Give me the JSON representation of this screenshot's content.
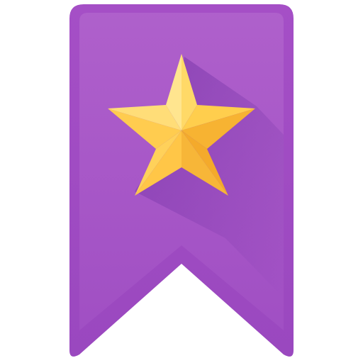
{
  "icon": {
    "name": "bookmark-star-icon",
    "ribbon_color": "#9f4cc3",
    "ribbon_inner_color": "#a956c8",
    "shadow_color": "#7a3aa6",
    "star_light_color": "#ffd45e",
    "star_dark_color": "#f6ad2b"
  }
}
